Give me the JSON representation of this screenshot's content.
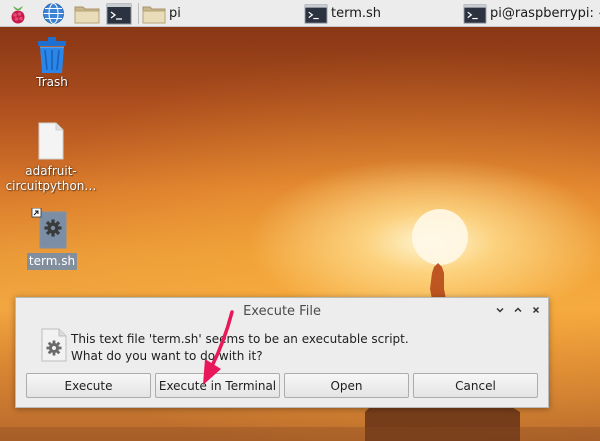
{
  "taskbar": {
    "menu_icon": "raspberry-pi-icon",
    "browser_icon": "globe-icon",
    "file_manager_icon": "folder-icon",
    "terminal_icon": "terminal-icon",
    "windows": [
      {
        "label": "pi",
        "icon": "folder-icon"
      },
      {
        "label": "term.sh",
        "icon": "terminal-icon"
      },
      {
        "label": "pi@raspberrypi: ~",
        "icon": "terminal-icon"
      }
    ]
  },
  "desktop": {
    "icons": [
      {
        "label": "Trash",
        "icon": "trash-icon"
      },
      {
        "label_line1": "adafruit-",
        "label_line2": "circuitpython…",
        "icon": "file-icon"
      },
      {
        "label": "term.sh",
        "icon": "script-file-icon",
        "selected": true
      }
    ]
  },
  "dialog": {
    "title": "Execute File",
    "message_line1": "This text file 'term.sh' seems to be an executable script.",
    "message_line2": "What do you want to do with it?",
    "buttons": {
      "execute": "Execute",
      "execute_in_terminal": "Execute in Terminal",
      "open": "Open",
      "cancel": "Cancel"
    },
    "window_controls": [
      "minimize",
      "maximize",
      "close"
    ]
  },
  "annotation": {
    "color": "#e8195a"
  }
}
